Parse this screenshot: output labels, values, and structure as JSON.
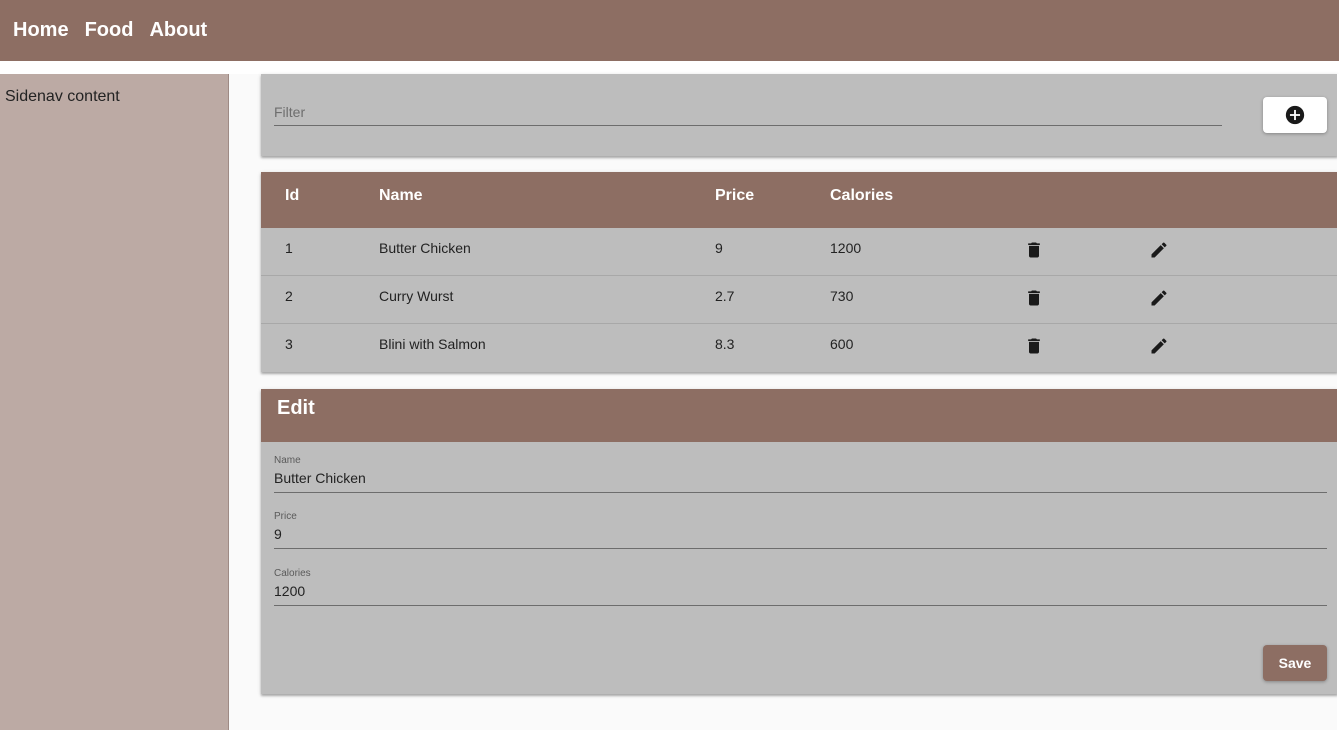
{
  "nav": {
    "home": "Home",
    "food": "Food",
    "about": "About"
  },
  "sidenav": {
    "content": "Sidenav content"
  },
  "filter": {
    "placeholder": "Filter",
    "add_icon": "add-circle-icon"
  },
  "table": {
    "headers": {
      "id": "Id",
      "name": "Name",
      "price": "Price",
      "calories": "Calories"
    },
    "rows": [
      {
        "id": "1",
        "name": "Butter Chicken",
        "price": "9",
        "calories": "1200"
      },
      {
        "id": "2",
        "name": "Curry Wurst",
        "price": "2.7",
        "calories": "730"
      },
      {
        "id": "3",
        "name": "Blini with Salmon",
        "price": "8.3",
        "calories": "600"
      }
    ],
    "delete_icon": "trash-icon",
    "edit_icon": "pencil-icon"
  },
  "edit": {
    "title": "Edit",
    "name_label": "Name",
    "name_value": "Butter Chicken",
    "price_label": "Price",
    "price_value": "9",
    "calories_label": "Calories",
    "calories_value": "1200",
    "save_label": "Save"
  },
  "colors": {
    "primary": "#8d6e63",
    "sidenav": "#bcaaa4",
    "card": "#bdbdbd"
  }
}
